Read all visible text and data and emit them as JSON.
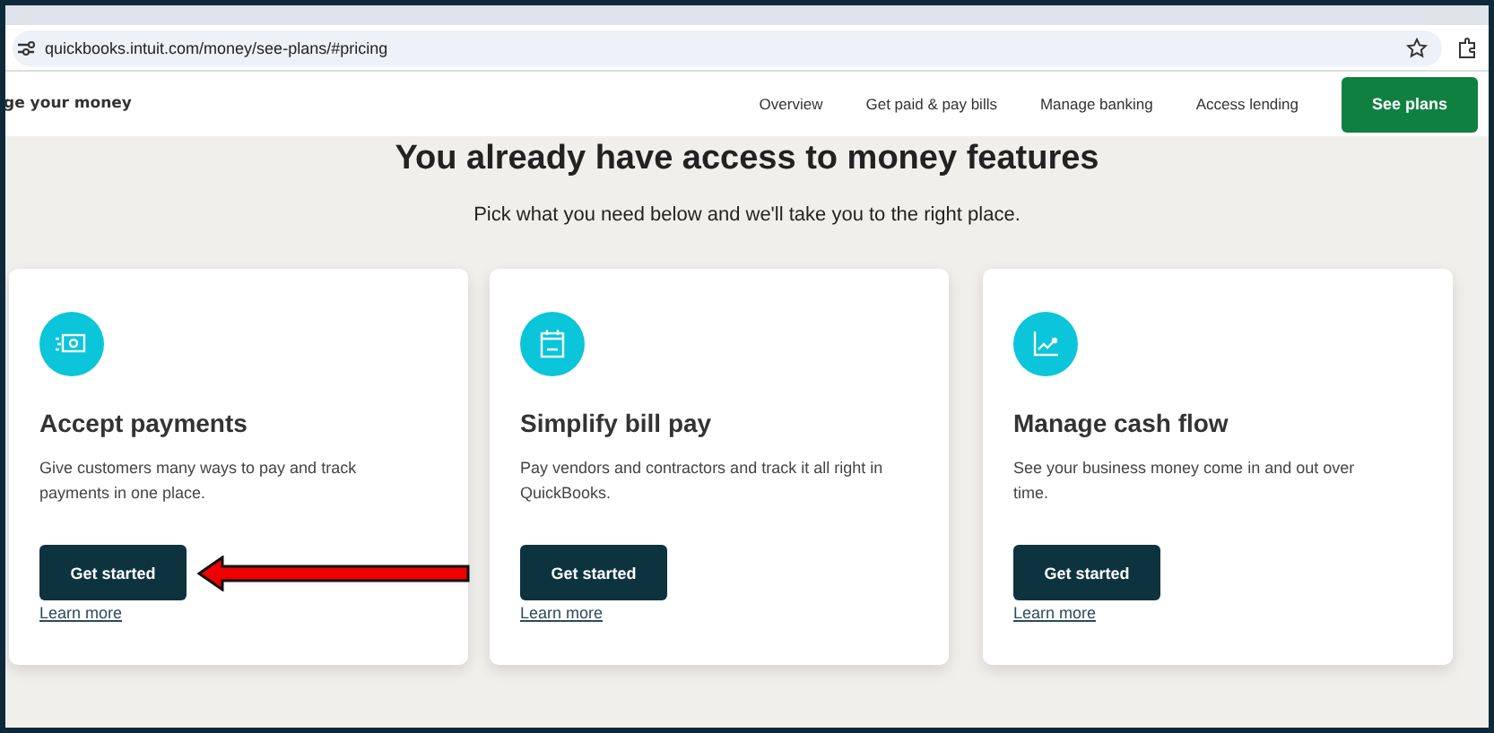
{
  "browser": {
    "url": "quickbooks.intuit.com/money/see-plans/#pricing"
  },
  "nav": {
    "section_title": "ge your money",
    "links": [
      "Overview",
      "Get paid & pay bills",
      "Manage banking",
      "Access lending"
    ],
    "cta": "See plans"
  },
  "hero": {
    "heading": "You already have access to money features",
    "subtitle": "Pick what you need below and we'll take you to the right place."
  },
  "cards": [
    {
      "kind": "payments",
      "title": "Accept payments",
      "description": "Give customers many ways to pay and track payments in one place.",
      "button": "Get started",
      "link": "Learn more",
      "highlighted": true
    },
    {
      "kind": "bills",
      "title": "Simplify bill pay",
      "description": "Pay vendors and contractors and track it all right in QuickBooks.",
      "button": "Get started",
      "link": "Learn more",
      "highlighted": false
    },
    {
      "kind": "cashflow",
      "title": "Manage cash flow",
      "description": "See your business money come in and out over time.",
      "button": "Get started",
      "link": "Learn more",
      "highlighted": false
    }
  ]
}
